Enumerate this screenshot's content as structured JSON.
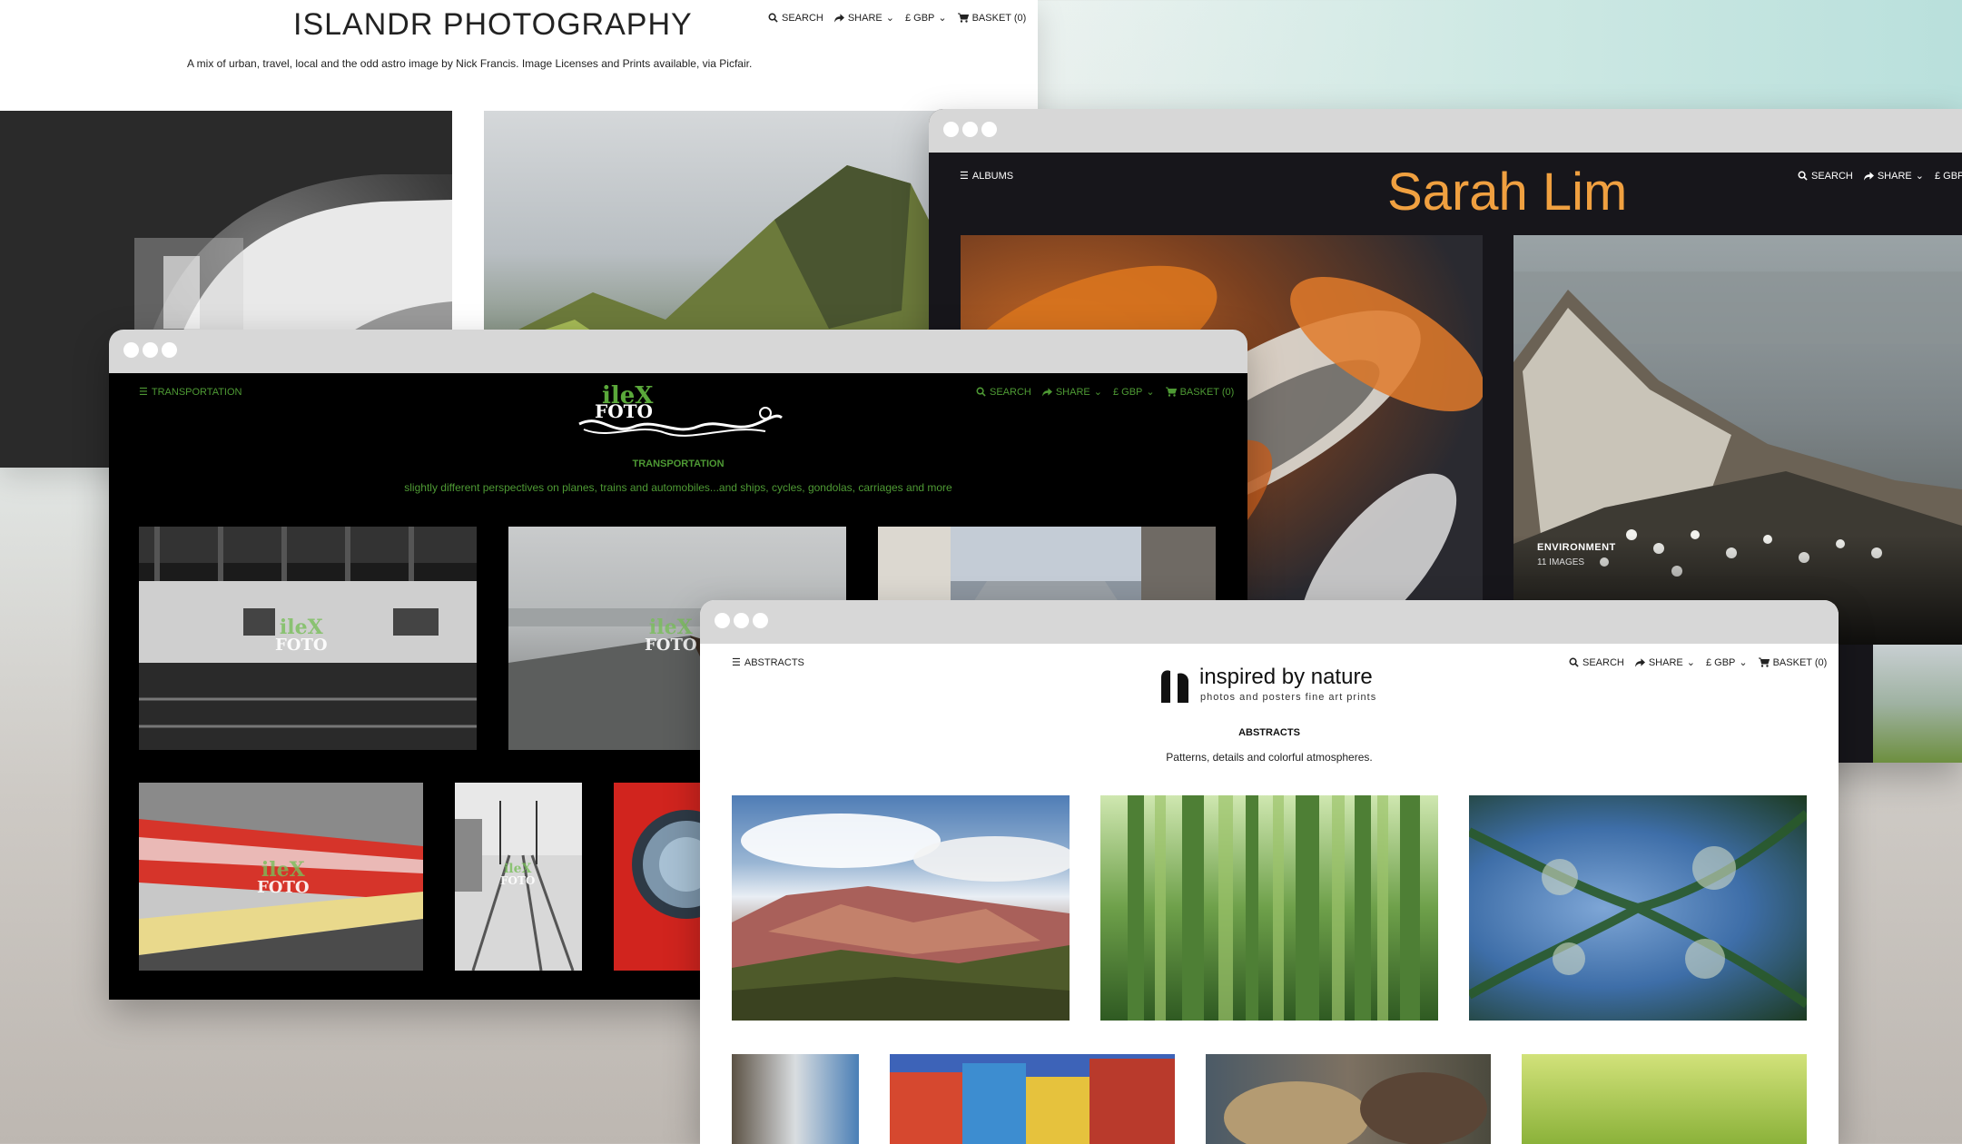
{
  "islandr": {
    "title": "ISLANDR PHOTOGRAPHY",
    "tagline": "A mix of urban, travel, local and the odd astro image by Nick Francis. Image Licenses and Prints available, via Picfair.",
    "nav": {
      "search": "SEARCH",
      "share": "SHARE",
      "currency": "£ GBP",
      "basket": "BASKET (0)"
    }
  },
  "sarah": {
    "menu": "ALBUMS",
    "title": "Sarah Lim",
    "nav": {
      "search": "SEARCH",
      "share": "SHARE",
      "currency": "£ GBP"
    },
    "album": {
      "name": "ENVIRONMENT",
      "count": "11 IMAGES"
    },
    "accent": "#f0a040"
  },
  "ilex": {
    "menu": "TRANSPORTATION",
    "logo_top": "ileX",
    "logo_bottom": "FOTO",
    "nav": {
      "search": "SEARCH",
      "share": "SHARE",
      "currency": "£ GBP",
      "basket": "BASKET (0)"
    },
    "heading": "TRANSPORTATION",
    "description": "slightly different perspectives on planes, trains and automobiles...and ships, cycles, gondolas, carriages and more",
    "accent": "#4e9a34",
    "watermark_top": "ileX",
    "watermark_bottom": "FOTO"
  },
  "nature": {
    "menu": "ABSTRACTS",
    "logo_title": "inspired by nature",
    "logo_sub": "photos and posters fine art prints",
    "nav": {
      "search": "SEARCH",
      "share": "SHARE",
      "currency": "£ GBP",
      "basket": "BASKET (0)"
    },
    "heading": "ABSTRACTS",
    "description": "Patterns, details and colorful atmospheres."
  }
}
